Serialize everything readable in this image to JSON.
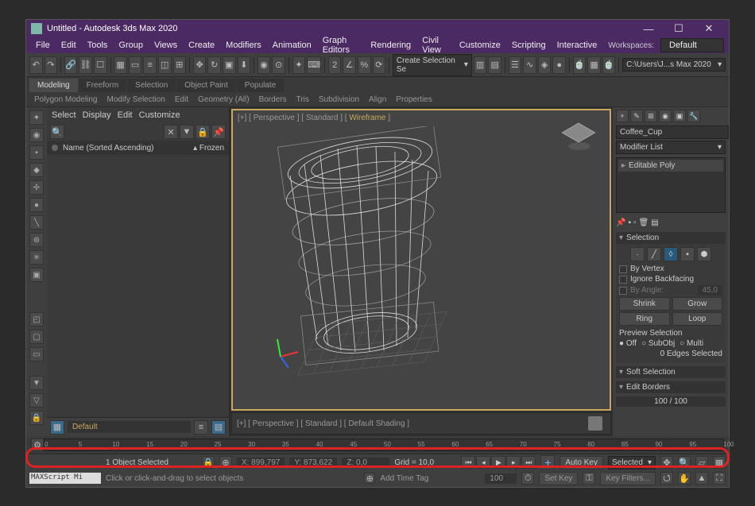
{
  "title": "Untitled - Autodesk 3ds Max 2020",
  "menu": [
    "File",
    "Edit",
    "Tools",
    "Group",
    "Views",
    "Create",
    "Modifiers",
    "Animation",
    "Graph Editors",
    "Rendering",
    "Civil View",
    "Customize",
    "Scripting",
    "Interactive"
  ],
  "workspace_label": "Workspaces:",
  "workspace_value": "Default",
  "project_path": "C:\\Users\\J...s Max 2020",
  "create_dd": "Create Selection Se",
  "ribbon_tabs": [
    "Modeling",
    "Freeform",
    "Selection",
    "Object Paint",
    "Populate"
  ],
  "subribbon": [
    "Polygon Modeling",
    "Modify Selection",
    "Edit",
    "Geometry (All)",
    "Borders",
    "Tris",
    "Subdivision",
    "Align",
    "Properties"
  ],
  "se_menu": [
    "Select",
    "Display",
    "Edit",
    "Customize"
  ],
  "se_col_name": "Name (Sorted Ascending)",
  "se_col_frozen": "▴ Frozen",
  "layer_default": "Default",
  "vp_label_pre": "[+] [ Perspective ] [ Standard ] [ ",
  "vp_label_wf": "Wireframe",
  "vp_label_post": " ]",
  "vp_strip_label": "[+] [ Perspective ] [ Standard ] [ Default Shading ]",
  "object_name": "Coffee_Cup",
  "modifier_list": "Modifier List",
  "mod_item": "Editable Poly",
  "rollout_selection": "Selection",
  "by_vertex": "By Vertex",
  "ignore_backfacing": "Ignore Backfacing",
  "by_angle": "By Angle:",
  "angle_val": "45,0",
  "shrink": "Shrink",
  "grow": "Grow",
  "ring": "Ring",
  "loop": "Loop",
  "preview_sel": "Preview Selection",
  "off": "Off",
  "subobj": "SubObj",
  "multi": "Multi",
  "edges_selected": "0 Edges Selected",
  "rollout_soft": "Soft Selection",
  "rollout_editb": "Edit Borders",
  "frame_ind": "100 / 100",
  "ticks": [
    "0",
    "5",
    "10",
    "15",
    "20",
    "25",
    "30",
    "35",
    "40",
    "45",
    "50",
    "55",
    "60",
    "65",
    "70",
    "75",
    "80",
    "85",
    "90",
    "95",
    "100"
  ],
  "status_sel": "1 Object Selected",
  "coord_x": "X: 899,797",
  "coord_y": "Y: 873,622",
  "coord_z": "Z: 0,0",
  "grid": "Grid = 10,0",
  "maxscript": "MAXScript Mi",
  "hint": "Click or click-and-drag to select objects",
  "add_time_tag": "Add Time Tag",
  "frame_cur": "100",
  "auto_key": "Auto Key",
  "set_key": "Set Key",
  "selected": "Selected",
  "key_filters": "Key Filters..."
}
